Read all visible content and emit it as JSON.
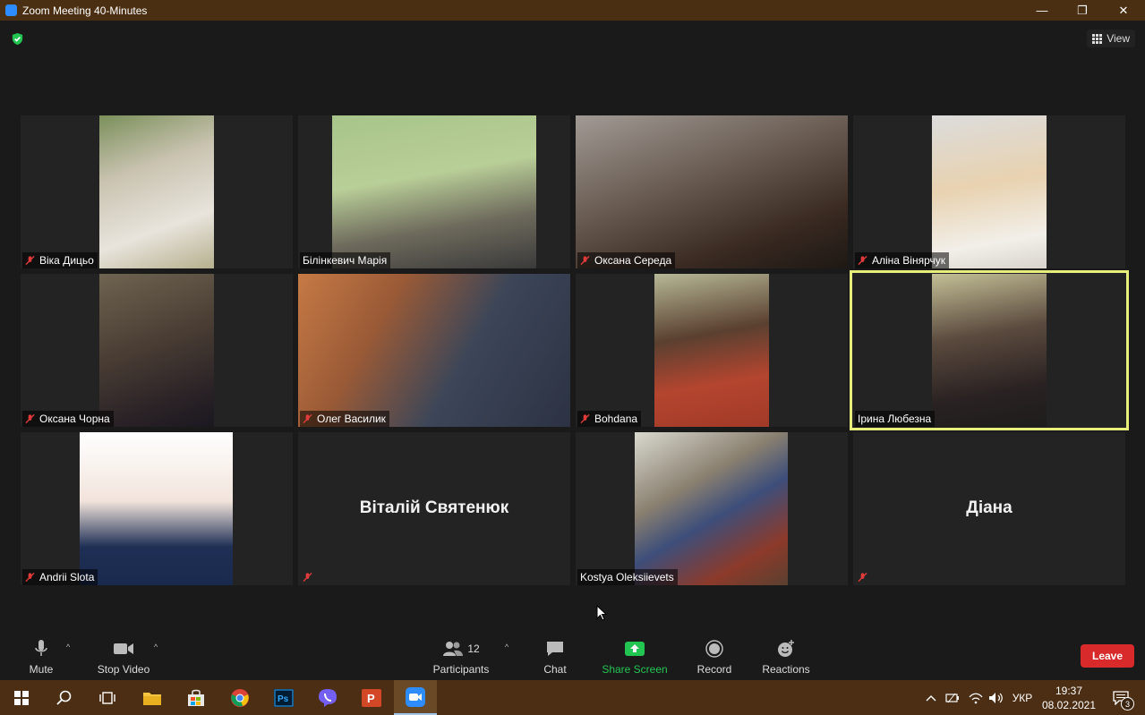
{
  "window": {
    "title": "Zoom Meeting 40-Minutes",
    "minimize": "—",
    "maximize": "❐",
    "close": "✕"
  },
  "header": {
    "view_label": "View"
  },
  "participants": [
    {
      "name": "Віка Дицьо",
      "muted": true
    },
    {
      "name": "Білінкевич Марія",
      "muted": false
    },
    {
      "name": "Оксана Середа",
      "muted": true
    },
    {
      "name": "Аліна Вінярчук",
      "muted": true
    },
    {
      "name": "Оксана Чорна",
      "muted": true
    },
    {
      "name": "Олег Василик",
      "muted": true
    },
    {
      "name": "Bohdana",
      "muted": true
    },
    {
      "name": "Ірина Любезна",
      "muted": false,
      "speaking": true
    },
    {
      "name": "Andrii Slota",
      "muted": true
    },
    {
      "name": "Віталій Святенюк",
      "muted": true,
      "video_off": true
    },
    {
      "name": "Kostya Oleksiievets",
      "muted": false
    },
    {
      "name": "Діана",
      "muted": true,
      "video_off": true
    }
  ],
  "toolbar": {
    "mute": "Mute",
    "stop_video": "Stop Video",
    "participants": "Participants",
    "participants_count": "12",
    "chat": "Chat",
    "share_screen": "Share Screen",
    "record": "Record",
    "reactions": "Reactions",
    "leave": "Leave"
  },
  "taskbar": {
    "language": "УКР",
    "time": "19:37",
    "date": "08.02.2021",
    "notifications_count": "3"
  },
  "colors": {
    "accent_speaking": "#e7ee7c",
    "leave_red": "#d82a2a",
    "share_green": "#23c552",
    "titlebar": "#4a2f12"
  }
}
